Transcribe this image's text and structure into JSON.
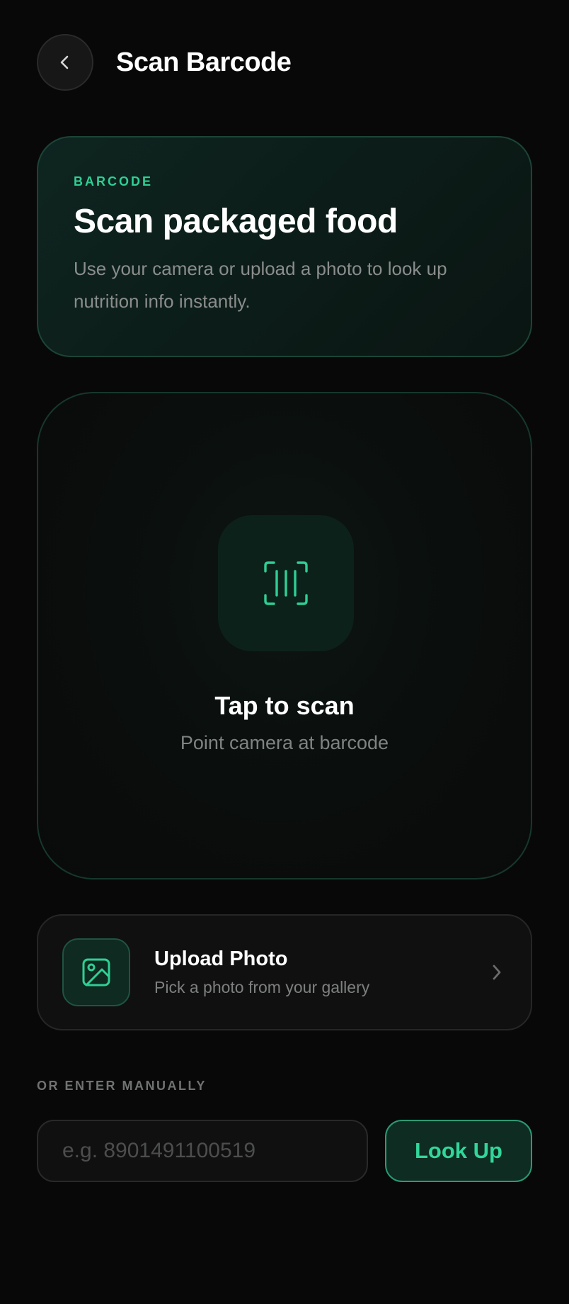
{
  "header": {
    "title": "Scan Barcode",
    "back_icon": "chevron-left-icon"
  },
  "hero": {
    "eyebrow": "BARCODE",
    "title": "Scan packaged food",
    "subtitle": "Use your camera or upload a photo to look up nutrition info instantly."
  },
  "scan": {
    "icon": "barcode-scan-icon",
    "title": "Tap to scan",
    "subtitle": "Point camera at barcode"
  },
  "upload": {
    "icon": "image-icon",
    "title": "Upload Photo",
    "subtitle": "Pick a photo from your gallery",
    "chevron_icon": "chevron-right-icon"
  },
  "manual": {
    "label": "OR ENTER MANUALLY",
    "placeholder": "e.g. 8901491100519",
    "value": "",
    "button_label": "Look Up"
  },
  "colors": {
    "background": "#080808",
    "accent": "#2fcf94",
    "accent_dark": "#0f2c22",
    "muted_text": "#7f8381"
  }
}
